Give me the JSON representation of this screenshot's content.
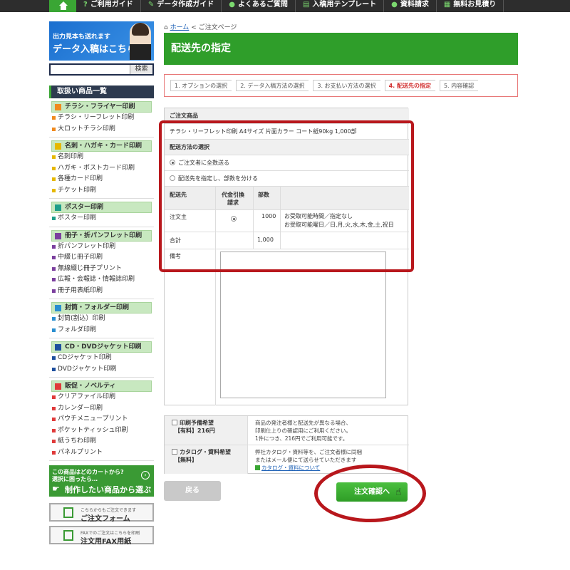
{
  "nav": {
    "items": [
      "ご利用ガイド",
      "データ作成ガイド",
      "よくあるご質問",
      "入稿用テンプレート",
      "資料請求",
      "無料お見積り"
    ]
  },
  "sidebar": {
    "banner_small": "出力見本も送れます",
    "banner_big": "データ入稿はこちら",
    "search_button": "検索",
    "categories_heading": "取扱い商品一覧",
    "categories": [
      {
        "title": "チラシ・フライヤー印刷",
        "items": [
          "チラシ・リーフレット印刷",
          "大ロットチラシ印刷"
        ]
      },
      {
        "title": "名刺・ハガキ・カード印刷",
        "items": [
          "名刺印刷",
          "ハガキ・ポストカード印刷",
          "各種カード印刷",
          "チケット印刷"
        ]
      },
      {
        "title": "ポスター印刷",
        "items": [
          "ポスター印刷"
        ]
      },
      {
        "title": "冊子・折パンフレット印刷",
        "items": [
          "折パンフレット印刷",
          "中綴じ冊子印刷",
          "無線綴じ冊子プリント",
          "広報・会報誌・情報誌印刷",
          "冊子用表紙印刷"
        ]
      },
      {
        "title": "封筒・フォルダー印刷",
        "items": [
          "封筒(割込）印刷",
          "フォルダ印刷"
        ]
      },
      {
        "title": "CD・DVDジャケット印刷",
        "items": [
          "CDジャケット印刷",
          "DVDジャケット印刷"
        ]
      },
      {
        "title": "販促・ノベルティ",
        "items": [
          "クリアファイル印刷",
          "カレンダー印刷",
          "パウチメニュープリント",
          "ポケットティッシュ印刷",
          "紙うちわ印刷",
          "パネルプリント"
        ]
      }
    ],
    "choose_line1": "この商品はどのカートから?",
    "choose_line2": "選択に困ったら…",
    "choose_line3": "制作したい商品から選ぶ",
    "form_small": "こちらからもご注文できます",
    "form_big": "ご注文フォーム",
    "fax_small": "FAXでのご注文はこちらを印刷",
    "fax_big": "注文用FAX用紙"
  },
  "breadcrumb": {
    "home": "ホーム",
    "sep": "<",
    "current": "ご注文ページ"
  },
  "page_title": "配送先の指定",
  "steps": [
    "1. オプションの選択",
    "2. データ入稿方法の選択",
    "3. お支払い方法の選択",
    "4. 配送先の指定",
    "5. 内容確認"
  ],
  "order": {
    "section_label": "ご注文商品",
    "product": "チラシ・リーフレット印刷 A4サイズ 片面カラー コート紙90kg 1,000部",
    "shipping_method_label": "配送方法の選択",
    "option_all": "ご注文者に全数送る",
    "option_split": "配送先を指定し、部数を分ける",
    "col_dest": "配送先",
    "col_cod_1": "代金引換",
    "col_cod_2": "請求",
    "col_qty": "部数",
    "row_dest": "注文主",
    "row_qty": "1000",
    "row_note1": "お受取可能時間／指定なし",
    "row_note2": "お受取可能曜日／日,月,火,水,木,金,土,祝日",
    "total_label": "合計",
    "total_qty": "1,000",
    "remarks_label": "備考"
  },
  "options": {
    "proof_title": "印刷予備希望",
    "proof_price": "【有料】216円",
    "proof_desc1": "商品の発注者様と配送先が異なる場合、",
    "proof_desc2": "印刷仕上りの確認用にご利用ください。",
    "proof_desc3": "1件につき、216円でご利用可能です。",
    "catalog_title": "カタログ・資料希望",
    "catalog_price": "【無料】",
    "catalog_desc1": "弊社カタログ・資料等を、ご注文者様に同梱",
    "catalog_desc2": "またはメール便にて送らせていただきます",
    "catalog_link": "カタログ・資料について"
  },
  "buttons": {
    "back": "戻る",
    "confirm": "注文確認へ"
  },
  "colors": {
    "green": "#2f9e2a",
    "highlight_red": "#b8171c",
    "nav_dark": "#2d2d2d"
  }
}
